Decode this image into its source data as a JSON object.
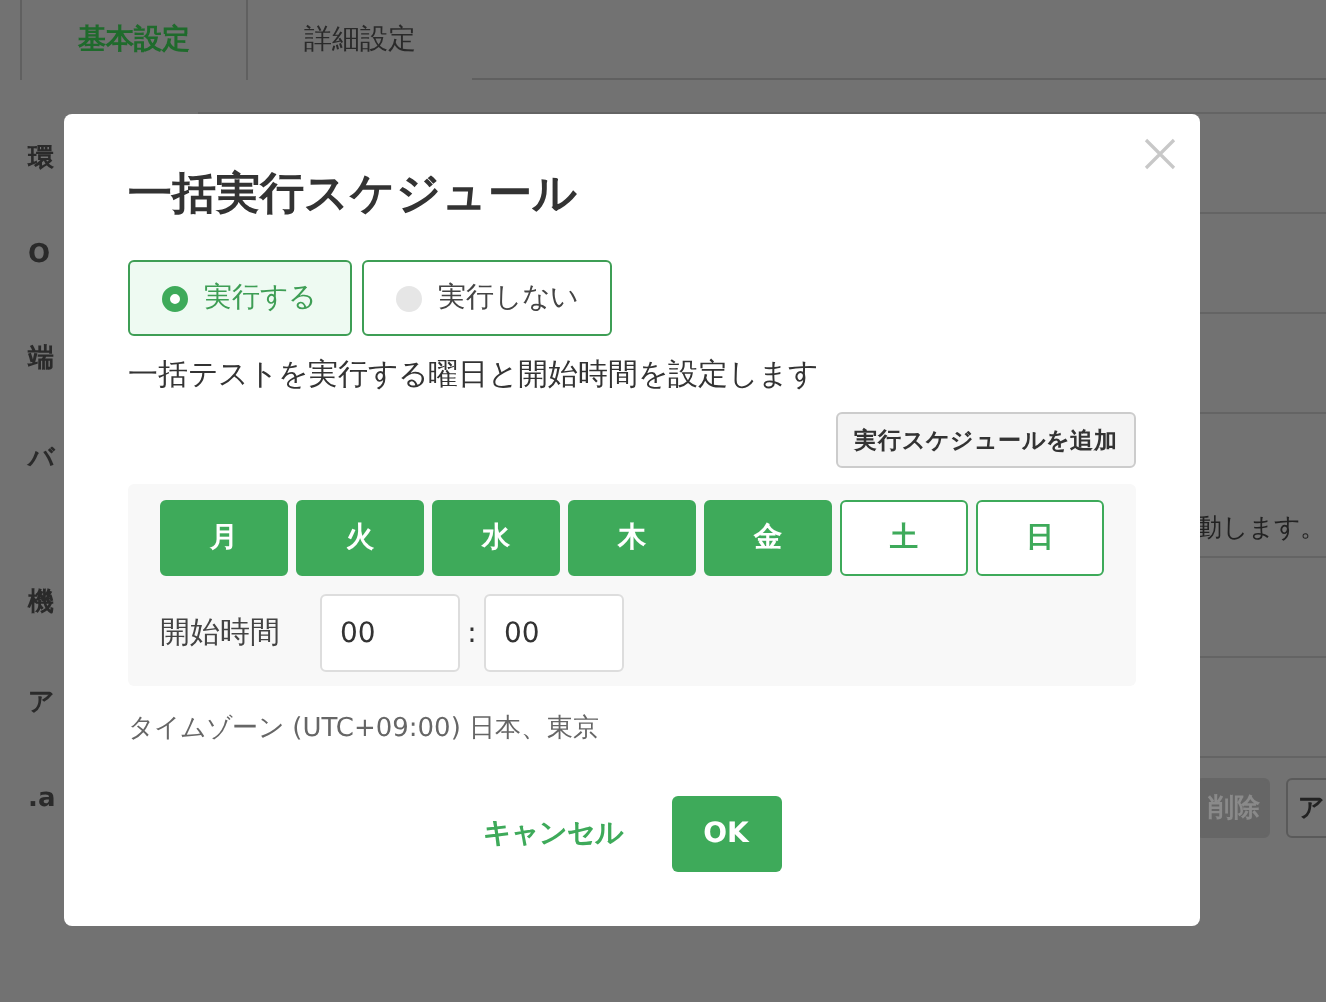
{
  "tabs": [
    {
      "label": "基本設定",
      "selected": true
    },
    {
      "label": "詳細設定",
      "selected": false
    }
  ],
  "background_rows": [
    {
      "label": "環"
    },
    {
      "label": "O"
    },
    {
      "label": "端"
    },
    {
      "label": "バ",
      "note": "動します。"
    },
    {
      "label": "機"
    },
    {
      "label": "ア"
    },
    {
      "label": ".a",
      "buttons": [
        {
          "label": "削除",
          "disabled": true
        },
        {
          "label": "ア",
          "disabled": false
        }
      ]
    }
  ],
  "dialog": {
    "title": "一括実行スケジュール",
    "options": [
      {
        "label": "実行する",
        "selected": true
      },
      {
        "label": "実行しない",
        "selected": false
      }
    ],
    "description": "一括テストを実行する曜日と開始時間を設定します",
    "add_button": "実行スケジュールを追加",
    "days": [
      {
        "label": "月",
        "selected": true
      },
      {
        "label": "火",
        "selected": true
      },
      {
        "label": "水",
        "selected": true
      },
      {
        "label": "木",
        "selected": true
      },
      {
        "label": "金",
        "selected": true
      },
      {
        "label": "土",
        "selected": false
      },
      {
        "label": "日",
        "selected": false
      }
    ],
    "start_label": "開始時間",
    "hour": "00",
    "separator": ":",
    "minute": "00",
    "timezone": "タイムゾーン (UTC+09:00) 日本、東京",
    "cancel": "キャンセル",
    "ok": "OK"
  }
}
